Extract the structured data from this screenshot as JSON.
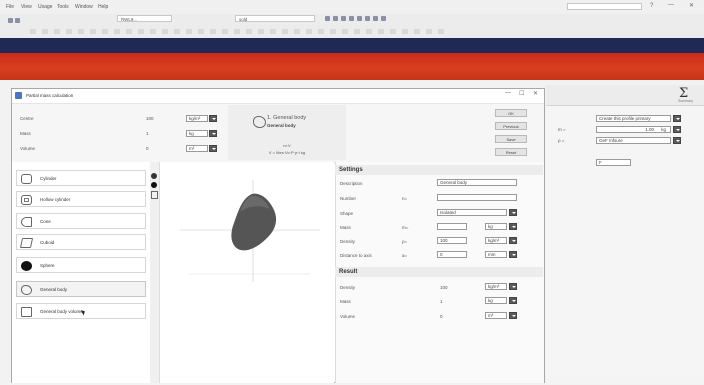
{
  "menu": {
    "items": [
      "File",
      "View",
      "Usage",
      "Tools",
      "Window",
      "Help"
    ]
  },
  "toolbar": {
    "combo_value": "RWL9...",
    "find_value": "sold"
  },
  "right_panel": {
    "sum_label": "Σ",
    "sum_sub": "Summary",
    "row1_value": "Create this profile primary",
    "row2_label": "m =",
    "row2_value": "1.00",
    "row2_unit": "kg",
    "row3_label": "ρ =",
    "row3_value": "GeF mfsure",
    "row4_value": "F"
  },
  "dialog": {
    "title": "Partial mass calculation",
    "rows": [
      {
        "label": "Centre",
        "value": "100",
        "unit": "kg/m³"
      },
      {
        "label": "Mass",
        "value": "1",
        "unit": "kg"
      },
      {
        "label": "Volume",
        "value": "0",
        "unit": "m³"
      }
    ],
    "center_title": "1. General body",
    "center_sub": "General body",
    "formula_top": "m·V",
    "formula_bottom": "V = Mes·Vo·P·ρ·t kg",
    "buttons": [
      "OK",
      "Previous",
      "Save",
      "Reset"
    ],
    "shapes": [
      "Cylinder",
      "Hollow cylinder",
      "Cone",
      "Cuboid",
      "Sphere",
      "General body",
      "General body volume"
    ],
    "settings_heading": "Settings",
    "settings": [
      {
        "label": "Description",
        "sym": "",
        "value": "General body",
        "unit": ""
      },
      {
        "label": "Number",
        "sym": "n=",
        "value": "",
        "unit": ""
      },
      {
        "label": "Shape",
        "sym": "",
        "value": "Isolated",
        "unit": ""
      },
      {
        "label": "Mass",
        "sym": "m=",
        "value": "",
        "unit": "kg"
      },
      {
        "label": "Density",
        "sym": "ρ=",
        "value": "100",
        "unit": "kg/m³"
      },
      {
        "label": "Distance to axis",
        "sym": "a=",
        "value": "0",
        "unit": "mm"
      }
    ],
    "result_heading": "Result",
    "results": [
      {
        "label": "Density",
        "value": "100",
        "unit": "kg/m³"
      },
      {
        "label": "Mass",
        "value": "1",
        "unit": "kg"
      },
      {
        "label": "Volume",
        "value": "0",
        "unit": "m³"
      }
    ]
  }
}
